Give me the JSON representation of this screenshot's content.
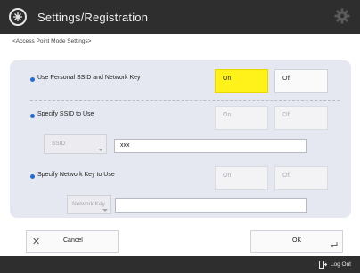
{
  "header": {
    "title": "Settings/Registration"
  },
  "breadcrumb": "<Access Point Mode Settings>",
  "settings": {
    "personal_ssid": {
      "label": "Use Personal SSID and Network Key",
      "on_label": "On",
      "off_label": "Off",
      "selected": "On"
    },
    "specify_ssid": {
      "label": "Specify SSID to Use",
      "on_label": "On",
      "off_label": "Off",
      "select_label": "SSID",
      "value": "xxx"
    },
    "specify_network_key": {
      "label": "Specify Network Key to Use",
      "on_label": "On",
      "off_label": "Off",
      "select_label": "Network Key",
      "value": ""
    }
  },
  "footer": {
    "cancel_label": "Cancel",
    "ok_label": "OK",
    "logout_label": "Log Out"
  },
  "colors": {
    "selected": "#fff21a",
    "header_bg": "#2e2e2e",
    "panel_bg": "#e6e8f1",
    "bullet": "#2a6acb"
  },
  "icons": [
    "logo-icon",
    "gear-icon",
    "close-icon",
    "enter-icon",
    "logout-icon"
  ]
}
